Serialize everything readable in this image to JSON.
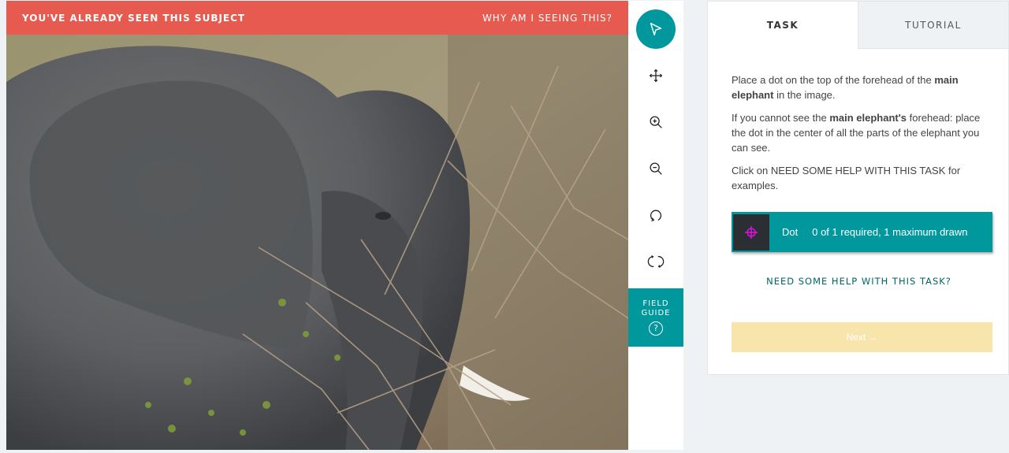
{
  "banner": {
    "left_text": "YOU'VE ALREADY SEEN THIS SUBJECT",
    "right_link": "WHY AM I SEEING THIS?",
    "color": "#e65a50"
  },
  "subject": {
    "image_description_icon": "elephant-photo"
  },
  "toolbar": {
    "tools": [
      {
        "icon": "pointer-icon",
        "active": true
      },
      {
        "icon": "move-icon",
        "active": false
      },
      {
        "icon": "zoom-in-icon",
        "active": false
      },
      {
        "icon": "zoom-out-icon",
        "active": false
      },
      {
        "icon": "rotate-icon",
        "active": false
      },
      {
        "icon": "reset-icon",
        "active": false
      }
    ],
    "field_guide_line1": "FIELD",
    "field_guide_line2": "GUIDE",
    "field_guide_icon": "?",
    "accent": "#00979d"
  },
  "panel": {
    "tabs": [
      {
        "label": "TASK",
        "active": true
      },
      {
        "label": "TUTORIAL",
        "active": false
      }
    ],
    "instructions": {
      "p1_before": "Place a dot on the top of the forehead of the ",
      "p1_bold": "main elephant",
      "p1_after": " in the image.",
      "p2_before": "If you cannot see the ",
      "p2_bold": "main elephant's",
      "p2_after": " forehead: place the dot in the center of all the parts of the elephant you can see.",
      "p3": "Click on NEED SOME HELP WITH THIS TASK for examples."
    },
    "tool_option": {
      "icon": "crosshair-icon",
      "icon_color": "#e010e0",
      "label": "Dot",
      "count_text": "0 of 1 required, 1 maximum drawn"
    },
    "help_link": "NEED SOME HELP WITH THIS TASK?",
    "next_button": "Next →",
    "next_color": "#f8e5ab"
  }
}
